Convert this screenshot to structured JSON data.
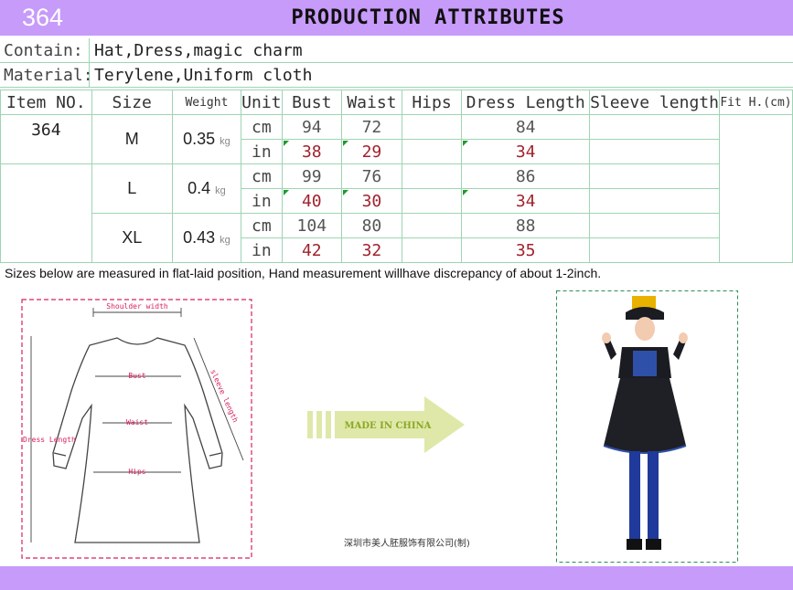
{
  "header": {
    "number": "364",
    "title": "PRODUCTION ATTRIBUTES"
  },
  "info": {
    "contain_label": "Contain:",
    "contain_value": "Hat,Dress,magic charm",
    "material_label": "Material:",
    "material_value": "Terylene,Uniform cloth"
  },
  "table": {
    "headers": [
      "Item NO.",
      "Size",
      "Weight",
      "Unit",
      "Bust",
      "Waist",
      "Hips",
      "Dress Length",
      "Sleeve length",
      "Fit H.(cm)"
    ],
    "item_no": "364",
    "weight_unit": "kg",
    "unit_cm": "cm",
    "unit_in": "in",
    "rows": [
      {
        "size": "M",
        "weight": "0.35",
        "cm": {
          "bust": "94",
          "waist": "72",
          "dress": "84"
        },
        "in": {
          "bust": "38",
          "waist": "29",
          "dress": "34"
        }
      },
      {
        "size": "L",
        "weight": "0.4",
        "cm": {
          "bust": "99",
          "waist": "76",
          "dress": "86"
        },
        "in": {
          "bust": "40",
          "waist": "30",
          "dress": "34"
        }
      },
      {
        "size": "XL",
        "weight": "0.43",
        "cm": {
          "bust": "104",
          "waist": "80",
          "dress": "88"
        },
        "in": {
          "bust": "42",
          "waist": "32",
          "dress": "35"
        }
      }
    ]
  },
  "note": "Sizes below are measured in flat-laid position, Hand measurement willhave discrepancy of about 1-2inch.",
  "diagram": {
    "shoulder": "Shoulder width",
    "sleeve": "sleeve length",
    "bust": "Bust",
    "waist": "Waist",
    "hips": "Hips",
    "dress_length": "Dress Length"
  },
  "arrow_text": "MADE IN CHINA",
  "credit": "深圳市美人胚服饰有限公司(制)",
  "colors": {
    "bar": "#c79bf9",
    "grid": "#9ed4b4",
    "inch_text": "#a0222c",
    "diagram": "#d8215a",
    "arrow": "#dfe8a8"
  }
}
